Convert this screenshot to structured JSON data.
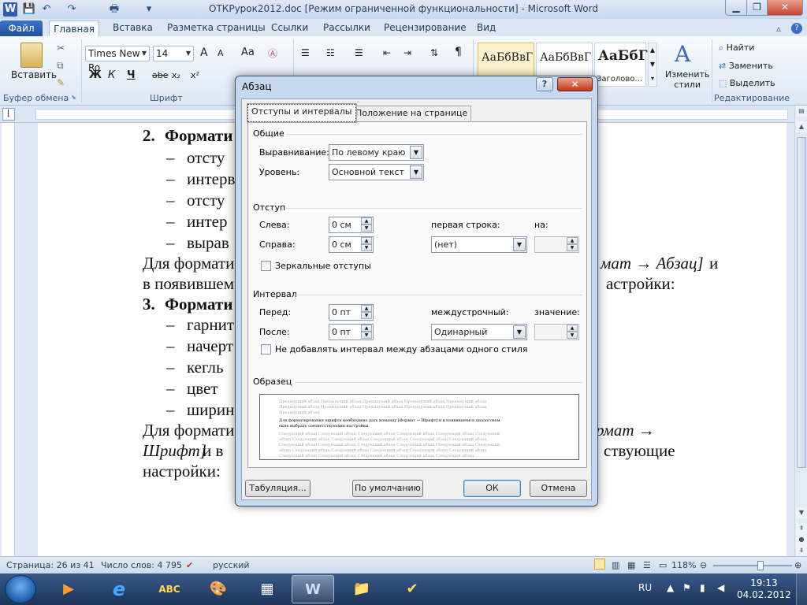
{
  "window": {
    "title": "ОТКРурок2012.doc [Режим ограниченной функциональности]  -  Microsoft Word",
    "min_glyph": "▁",
    "max_glyph": "❐",
    "close_glyph": "✕"
  },
  "qat": {
    "word_icon": "W",
    "save_icon": "💾",
    "undo_icon": "↶",
    "redo_icon": "↷",
    "print_icon": "🖶",
    "dropdown_icon": "▾"
  },
  "ribbon_tabs": {
    "file": "Файл",
    "home": "Главная",
    "items": [
      "Вставка",
      "Разметка страницы",
      "Ссылки",
      "Рассылки",
      "Рецензирование",
      "Вид"
    ],
    "minimize_glyph": "▵",
    "help_glyph": "?"
  },
  "ribbon": {
    "clipboard": {
      "paste": "Вставить",
      "group": "Буфер обмена"
    },
    "font": {
      "name": "Times New Ro",
      "size": "14",
      "grow": "A",
      "shrink": "A",
      "case": "Aa",
      "clear": "Ⓐ",
      "bold": "Ж",
      "italic": "К",
      "underline": "Ч",
      "strike": "abe",
      "sub": "x₂",
      "sup": "x²",
      "effects": "A",
      "highlight": "ab",
      "color": "A",
      "group": "Шрифт"
    },
    "paragraph": {
      "pilcrow": "¶"
    },
    "styles": {
      "sample1": "АаБбВвГ",
      "sample2": "АаБбВвГ",
      "sample3": "АаБбГ",
      "heading_label": "Заголово...",
      "change": "Изменить",
      "change2": "стили"
    },
    "editing": {
      "find": "Найти",
      "replace": "Заменить",
      "select": "Выделить",
      "group": "Редактирование"
    }
  },
  "document": {
    "item2_num": "2.",
    "item2_text": "Формати",
    "item3_num": "3.",
    "item3_text": "Формати",
    "bullets_a": [
      "отсту",
      "интерв",
      "отсту",
      "интер",
      "вырав"
    ],
    "bullets_b": [
      "гарнит",
      "начерт",
      "кегль",
      "цвет",
      "ширин"
    ],
    "dash": "–",
    "para1_a": "Для формати",
    "para1_a_end": "мат → Абзац]",
    "para1_a_tail": " и",
    "para1_b": "в появившем",
    "para1_b_end": "астройки:",
    "para2_a": "Для формати",
    "para2_a_end": "рмат →",
    "para2_b": "Шрифт]",
    "para2_b_mid": " и в",
    "para2_b_end": "ствующие",
    "para2_c": "настройки:"
  },
  "statusbar": {
    "page": "Страница: 26 из 41",
    "words": "Число слов: 4 795",
    "lang": "русский",
    "zoom": "118%",
    "zoom_level": 0.6
  },
  "dialog": {
    "title": "Абзац",
    "help": "?",
    "close": "✕",
    "tabs": {
      "indents": "Отступы и интервалы",
      "position": "Положение на странице"
    },
    "general": {
      "header": "Общие",
      "alignment_label": "Выравнивание:",
      "alignment_value": "По левому краю",
      "level_label": "Уровень:",
      "level_value": "Основной текст"
    },
    "indent": {
      "header": "Отступ",
      "left_label": "Слева:",
      "left_value": "0 см",
      "right_label": "Справа:",
      "right_value": "0 см",
      "first_label": "первая строка:",
      "first_value": "(нет)",
      "by_label": "на:",
      "mirror_label": "Зеркальные отступы"
    },
    "spacing": {
      "header": "Интервал",
      "before_label": "Перед:",
      "before_value": "0 пт",
      "after_label": "После:",
      "after_value": "0 пт",
      "line_label": "междустрочный:",
      "line_value": "Одинарный",
      "at_label": "значение:",
      "no_space_label": "Не добавлять интервал между абзацами одного стиля"
    },
    "preview": {
      "header": "Образец",
      "prev_lines": [
        "Предыдущий абзац Предыдущий абзац Предыдущий абзац Предыдущий абзац Предыдущий абзац",
        "Предыдущий абзац Предыдущий абзац Предыдущий абзац Предыдущий абзац Предыдущий абзац",
        "Предыдущий абзац"
      ],
      "sample_lines": [
        "Для форматирования шрифта необходимо дать команду [Формат → Шрифт] и в появившемся диалоговом",
        "окне выбрать соответствующие настройки."
      ],
      "next_lines": [
        "Следующий абзац Следующий абзац Следующий абзац Следующий абзац Следующий абзац Следующий",
        "абзац Следующий абзац Следующий абзац Следующий абзац Следующий абзац Следующий абзац",
        "Следующий абзац Следующий абзац Следующий абзац Следующий абзац Следующий абзац Следующий",
        "абзац Следующий абзац Следующий абзац Следующий абзац Следующий абзац Следующий абзац",
        "Следующий абзац Следующий абзац Следующий абзац Следующий абзац Следующий абзац"
      ]
    },
    "buttons": {
      "tabs": "Табуляция...",
      "default": "По умолчанию",
      "ok": "ОК",
      "cancel": "Отмена"
    }
  },
  "taskbar": {
    "apps": [
      "▶",
      "e",
      "ABC",
      "🎨",
      "▦",
      "W",
      "📁",
      "✔"
    ],
    "lang": "RU",
    "time": "19:13",
    "date": "04.02.2012"
  }
}
